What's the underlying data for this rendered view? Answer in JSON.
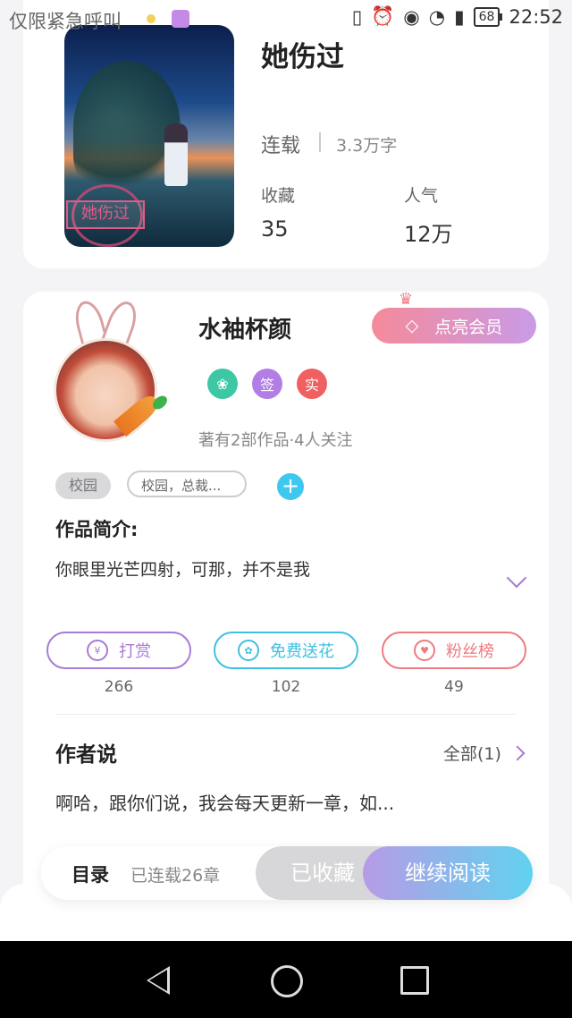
{
  "status_bar": {
    "left_text": "仅限紧急呼叫",
    "battery": "68",
    "time": "22:52",
    "icons": [
      "vibrate-icon",
      "alarm-icon",
      "eye-icon",
      "wifi-icon",
      "sim-icon",
      "battery-icon"
    ]
  },
  "book": {
    "cover_label": "她伤过",
    "title": "她伤过",
    "status": "连载",
    "word_count": "3.3万字",
    "favorites_label": "收藏",
    "favorites_value": "35",
    "popularity_label": "人气",
    "popularity_value": "12万"
  },
  "author": {
    "name": "水袖杯颜",
    "vip_button": "点亮会员",
    "badges": [
      "",
      "签",
      "实"
    ],
    "badge_colors": [
      "#3dc7a4",
      "#b27ee6",
      "#f06060"
    ],
    "works_info": "著有2部作品·4人关注"
  },
  "tags": {
    "tag1": "校园",
    "tag2": "校园，总裁..."
  },
  "intro": {
    "title": "作品简介:",
    "text": "你眼里光芒四射，可那，并不是我"
  },
  "actions": [
    {
      "label": "打赏",
      "count": "266",
      "color": "#a77bd6",
      "icon": "yen-icon"
    },
    {
      "label": "免费送花",
      "count": "102",
      "color": "#3fc0e0",
      "icon": "flower-icon"
    },
    {
      "label": "粉丝榜",
      "count": "49",
      "color": "#ef7b80",
      "icon": "fans-icon"
    }
  ],
  "author_says": {
    "title": "作者说",
    "all_label": "全部(1)",
    "text": "啊哈，跟你们说，我会每天更新一章，如..."
  },
  "bottom_bar": {
    "toc": "目录",
    "chapters": "已连载26章",
    "collected": "已收藏",
    "read": "继续阅读"
  }
}
